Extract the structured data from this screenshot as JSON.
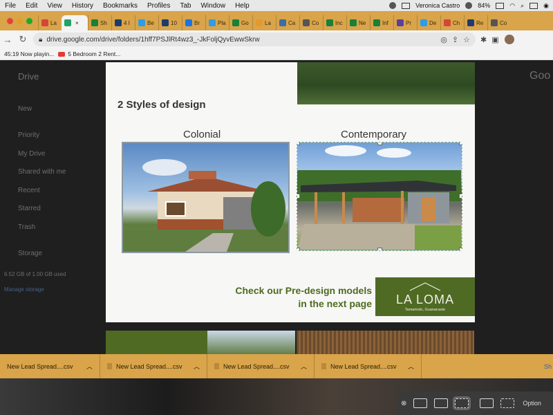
{
  "menubar": {
    "items": [
      "File",
      "Edit",
      "View",
      "History",
      "Bookmarks",
      "Profiles",
      "Tab",
      "Window",
      "Help"
    ],
    "user": "Veronica Castro",
    "battery": "84%"
  },
  "tabs": [
    {
      "label": "La",
      "color": "#d44638"
    },
    {
      "label": "",
      "color": "#1fa463",
      "active": true
    },
    {
      "label": "Sh",
      "color": "#188038"
    },
    {
      "label": "4 I",
      "color": "#1f3b6e"
    },
    {
      "label": "Be",
      "color": "#2e9ce6"
    },
    {
      "label": "10",
      "color": "#1f3b6e"
    },
    {
      "label": "Br",
      "color": "#1a73e8"
    },
    {
      "label": "Pla",
      "color": "#2e9ce6"
    },
    {
      "label": "Go",
      "color": "#188038"
    },
    {
      "label": "La",
      "color": "#e09a2e"
    },
    {
      "label": "Ca",
      "color": "#3a6ea5"
    },
    {
      "label": "Co",
      "color": "#555555"
    },
    {
      "label": "Inc",
      "color": "#188038"
    },
    {
      "label": "Ne",
      "color": "#188038"
    },
    {
      "label": "Inf",
      "color": "#188038"
    },
    {
      "label": "Pr",
      "color": "#5b3fa0"
    },
    {
      "label": "De",
      "color": "#2e9ce6"
    },
    {
      "label": "Ch",
      "color": "#d44638"
    },
    {
      "label": "Re",
      "color": "#1f3b6e"
    },
    {
      "label": "Co",
      "color": "#555555"
    }
  ],
  "toolbar": {
    "url": "drive.google.com/drive/folders/1hff7PSJlRt4wz3_-JkFoljQyvEwwSkrw"
  },
  "bookmarks": [
    {
      "label": "45:19 Now playin..."
    },
    {
      "label": "5 Bedroom 2 Rent..."
    }
  ],
  "drive_bg": {
    "brand": "Drive",
    "new_label": "New",
    "nav": [
      "Priority",
      "My Drive",
      "Shared with me",
      "Recent",
      "Starred",
      "Trash"
    ],
    "storage_label": "Storage",
    "storage_used": "6.52 GB of 1.00 GB used",
    "manage_storage": "Manage storage",
    "google": "Goo"
  },
  "slide": {
    "title": "2 Styles of design",
    "col1_label": "Colonial",
    "col2_label": "Contemporary",
    "cta_line1": "Check our Pre-design models",
    "cta_line2": "in the next page",
    "logo_brand": "LA LOMA",
    "logo_sub": "Tamarindo, Guanacaste"
  },
  "downloads": [
    {
      "label": "New Lead Spread....csv"
    },
    {
      "label": "New Lead Spread....csv"
    },
    {
      "label": "New Lead Spread....csv"
    },
    {
      "label": "New Lead Spread....csv"
    }
  ],
  "downloads_show_all": "Sh",
  "shotbar": {
    "options_label": "Option"
  }
}
